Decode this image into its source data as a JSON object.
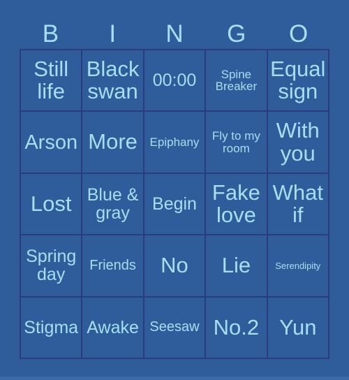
{
  "card": {
    "title": "BINGO",
    "background_color": "#2f5d9b",
    "grid_line_color": "#2b3b7d",
    "text_color": "#a6dff2",
    "headers": [
      {
        "letter": "B"
      },
      {
        "letter": "I"
      },
      {
        "letter": "N"
      },
      {
        "letter": "G"
      },
      {
        "letter": "O"
      }
    ],
    "rows": [
      [
        {
          "label": "Still life",
          "size": "fs-xl"
        },
        {
          "label": "Black swan",
          "size": "fs-xl"
        },
        {
          "label": "00:00",
          "size": "fs-md"
        },
        {
          "label": "Spine Breaker",
          "size": "fs-xs"
        },
        {
          "label": "Equal sign",
          "size": "fs-xl"
        }
      ],
      [
        {
          "label": "Arson",
          "size": "fs-lg"
        },
        {
          "label": "More",
          "size": "fs-xl"
        },
        {
          "label": "Epiphany",
          "size": "fs-xs"
        },
        {
          "label": "Fly to my room",
          "size": "fs-xs"
        },
        {
          "label": "With you",
          "size": "fs-xl"
        }
      ],
      [
        {
          "label": "Lost",
          "size": "fs-xl"
        },
        {
          "label": "Blue & gray",
          "size": "fs-md"
        },
        {
          "label": "Begin",
          "size": "fs-md"
        },
        {
          "label": "Fake love",
          "size": "fs-xl"
        },
        {
          "label": "What if",
          "size": "fs-xl"
        }
      ],
      [
        {
          "label": "Spring day",
          "size": "fs-md"
        },
        {
          "label": "Friends",
          "size": "fs-sm"
        },
        {
          "label": "No",
          "size": "fs-xl"
        },
        {
          "label": "Lie",
          "size": "fs-xl"
        },
        {
          "label": "Serendipity",
          "size": "fs-xxs"
        }
      ],
      [
        {
          "label": "Stigma",
          "size": "fs-md"
        },
        {
          "label": "Awake",
          "size": "fs-md"
        },
        {
          "label": "Seesaw",
          "size": "fs-sm"
        },
        {
          "label": "No.2",
          "size": "fs-xl"
        },
        {
          "label": "Yun",
          "size": "fs-xl"
        }
      ]
    ]
  }
}
